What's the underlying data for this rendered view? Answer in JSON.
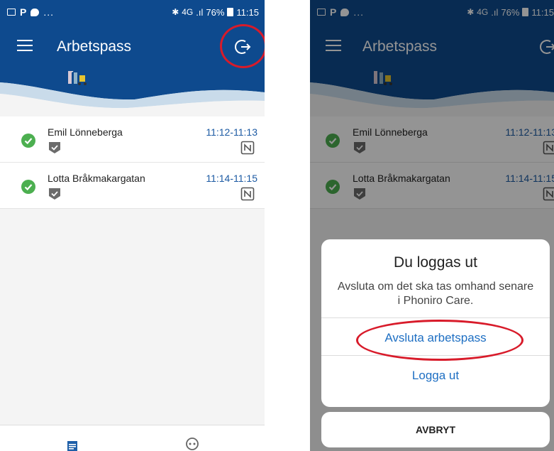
{
  "status_bar": {
    "battery": "76%",
    "time": "11:15",
    "network": "4G",
    "overflow": "..."
  },
  "app_bar": {
    "title": "Arbetspass"
  },
  "visits": [
    {
      "name": "Emil Lönneberga",
      "time": "11:12-11:13"
    },
    {
      "name": "Lotta Bråkmakargatan",
      "time": "11:14-11:15"
    }
  ],
  "dialog": {
    "title": "Du loggas ut",
    "message": "Avsluta om det ska tas omhand senare i Phoniro Care.",
    "end_shift_label": "Avsluta arbetspass",
    "logout_label": "Logga ut",
    "cancel_label": "AVBRYT"
  },
  "icons": {
    "menu": "menu-icon",
    "logout": "logout-icon",
    "check": "check-circle-icon",
    "shield": "shield-check-icon",
    "nfc": "nfc-icon",
    "calendar": "calendar-icon",
    "profile": "profile-icon"
  },
  "colors": {
    "primary": "#0e4a8e",
    "accent_link": "#1e6fc3",
    "time_text": "#1c5aa3",
    "check_green": "#4caf50",
    "highlight_red": "#d81b2a"
  }
}
